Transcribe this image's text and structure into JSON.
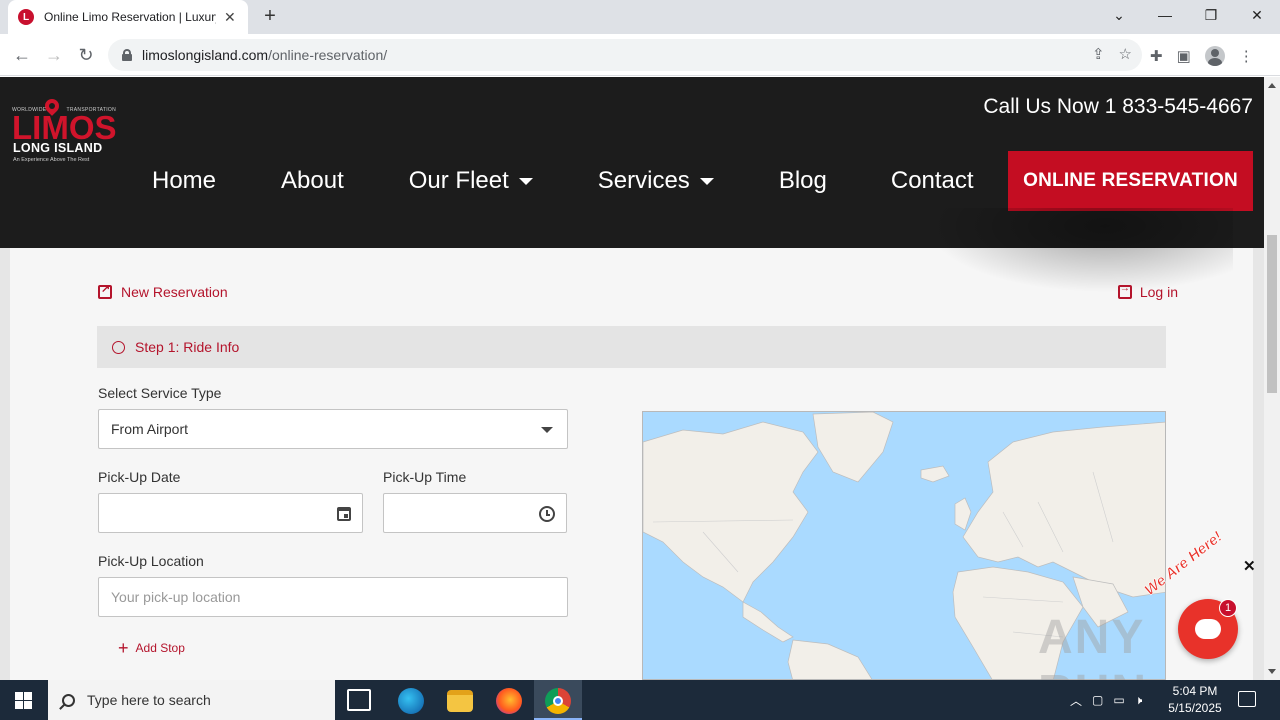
{
  "browser": {
    "tab_title": "Online Limo Reservation | Luxury",
    "url_host": "limoslongisland.com",
    "url_path": "/online-reservation/"
  },
  "site": {
    "logo": {
      "tag_left": "WORLDWIDE",
      "tag_right": "TRANSPORTATION",
      "brand": "LIMOS",
      "sub": "LONG ISLAND",
      "slogan": "An Experience Above The Rest"
    },
    "call_us": "Call Us Now 1 833-545-4667",
    "nav": [
      {
        "label": "Home"
      },
      {
        "label": "About"
      },
      {
        "label": "Our Fleet"
      },
      {
        "label": "Services"
      },
      {
        "label": "Blog"
      },
      {
        "label": "Contact"
      }
    ],
    "reserve_button": "ONLINE RESERVATION"
  },
  "form": {
    "new_reservation": "New Reservation",
    "login": "Log in",
    "step": "Step 1: Ride Info",
    "service_type_label": "Select Service Type",
    "service_type_value": "From Airport",
    "pickup_date_label": "Pick-Up Date",
    "pickup_time_label": "Pick-Up Time",
    "pickup_location_label": "Pick-Up Location",
    "pickup_location_placeholder": "Your pick-up location",
    "add_stop": "Add Stop"
  },
  "chat": {
    "badge": "1",
    "tagline": "We Are Here!"
  },
  "watermark": "ANY RUN",
  "taskbar": {
    "search_placeholder": "Type here to search",
    "time": "5:04 PM",
    "date": "5/15/2025"
  },
  "colors": {
    "brand_red": "#c40d22",
    "header_bg": "#1c1c1c",
    "map_water": "#aadaff",
    "map_land": "#f2efe9"
  }
}
